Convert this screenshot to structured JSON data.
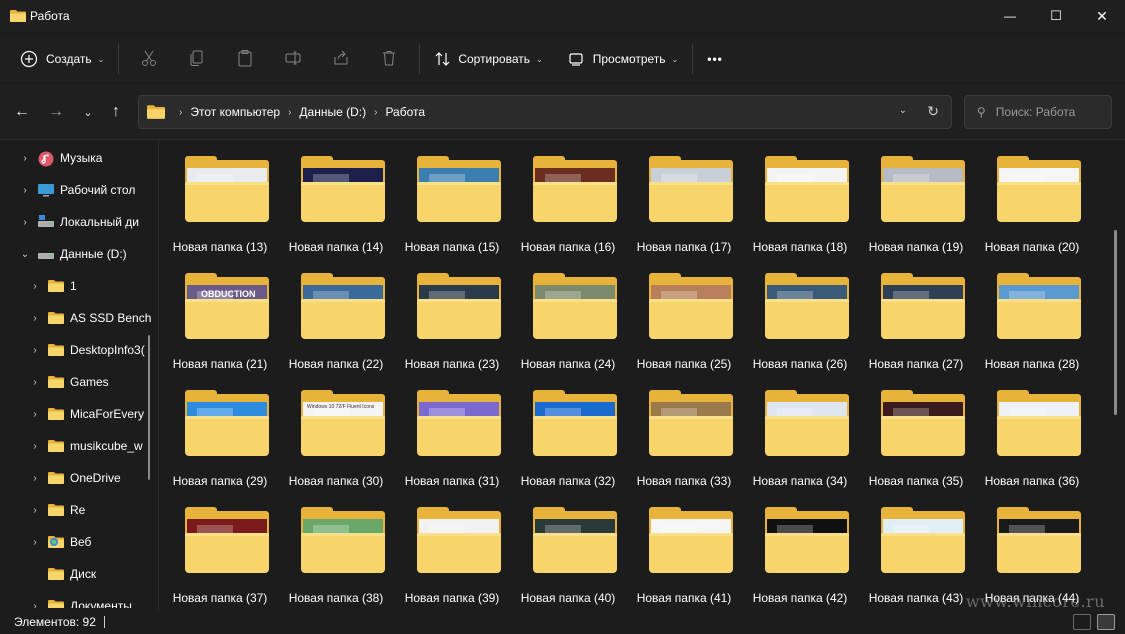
{
  "window": {
    "title": "Работа",
    "controls": {
      "minimize": "—",
      "maximize": "☐",
      "close": "✕"
    }
  },
  "toolbar": {
    "create_label": "Создать",
    "sort_label": "Сортировать",
    "view_label": "Просмотреть",
    "more_label": "•••"
  },
  "address": {
    "breadcrumbs": [
      "Этот компьютер",
      "Данные (D:)",
      "Работа"
    ],
    "search_placeholder": "Поиск: Работа"
  },
  "sidebar": {
    "items": [
      {
        "label": "Музыка",
        "icon": "music-icon",
        "expander": "›"
      },
      {
        "label": "Рабочий стол",
        "icon": "desktop-icon",
        "expander": "›"
      },
      {
        "label": "Локальный ди",
        "icon": "drive-icon",
        "expander": "›"
      },
      {
        "label": "Данные (D:)",
        "icon": "drive-icon",
        "expander": "⌄"
      },
      {
        "label": "1",
        "icon": "folder-icon",
        "expander": "›"
      },
      {
        "label": "AS SSD Bench",
        "icon": "folder-icon",
        "expander": "›"
      },
      {
        "label": "DesktopInfo3(",
        "icon": "folder-icon",
        "expander": "›"
      },
      {
        "label": "Games",
        "icon": "folder-icon",
        "expander": "›"
      },
      {
        "label": "MicaForEvery",
        "icon": "folder-icon",
        "expander": "›"
      },
      {
        "label": "musikcube_w",
        "icon": "folder-icon",
        "expander": "›"
      },
      {
        "label": "OneDrive",
        "icon": "folder-icon",
        "expander": "›"
      },
      {
        "label": "Re",
        "icon": "folder-icon",
        "expander": "›"
      },
      {
        "label": "Веб",
        "icon": "web-folder-icon",
        "expander": "›"
      },
      {
        "label": "Диск",
        "icon": "folder-icon",
        "expander": ""
      },
      {
        "label": "Документы",
        "icon": "folder-icon",
        "expander": "›"
      }
    ]
  },
  "folders": [
    {
      "label": "Новая папка (13)"
    },
    {
      "label": "Новая папка (14)"
    },
    {
      "label": "Новая папка (15)"
    },
    {
      "label": "Новая папка (16)"
    },
    {
      "label": "Новая папка (17)"
    },
    {
      "label": "Новая папка (18)"
    },
    {
      "label": "Новая папка (19)"
    },
    {
      "label": "Новая папка (20)"
    },
    {
      "label": "Новая папка (21)"
    },
    {
      "label": "Новая папка (22)"
    },
    {
      "label": "Новая папка (23)"
    },
    {
      "label": "Новая папка (24)"
    },
    {
      "label": "Новая папка (25)"
    },
    {
      "label": "Новая папка (26)"
    },
    {
      "label": "Новая папка (27)"
    },
    {
      "label": "Новая папка (28)"
    },
    {
      "label": "Новая папка (29)"
    },
    {
      "label": "Новая папка (30)"
    },
    {
      "label": "Новая папка (31)"
    },
    {
      "label": "Новая папка (32)"
    },
    {
      "label": "Новая папка (33)"
    },
    {
      "label": "Новая папка (34)"
    },
    {
      "label": "Новая папка (35)"
    },
    {
      "label": "Новая папка (36)"
    },
    {
      "label": "Новая папка (37)"
    },
    {
      "label": "Новая папка (38)"
    },
    {
      "label": "Новая папка (39)"
    },
    {
      "label": "Новая папка (40)"
    },
    {
      "label": "Новая папка (41)"
    },
    {
      "label": "Новая папка (42)"
    },
    {
      "label": "Новая папка (43)"
    },
    {
      "label": "Новая папка (44)"
    }
  ],
  "thumb_colors": [
    "#e9ecef",
    "#1b1f4a",
    "#3a7fb0",
    "#6b2d1f",
    "#c9cfd6",
    "#f4f4f4",
    "#b7bcc4",
    "#f5f5f5",
    "#6a5a8a",
    "#3a6a9a",
    "#2b3a4a",
    "#7a8a6a",
    "#b8805a",
    "#3a5a7a",
    "#2f3f55",
    "#5a9ad0",
    "#2d8ce0",
    "#f4f4f4",
    "#7a6ad0",
    "#1a6ad0",
    "#9a7a4a",
    "#dfe6f0",
    "#3a1a1a",
    "#eef1f5",
    "#7a1a1a",
    "#6aa86a",
    "#f2f2f2",
    "#2a3a3a",
    "#f6f6f6",
    "#101010",
    "#e0eef8",
    "#1a1a1a"
  ],
  "thumb_text": {
    "folder_30": "Windows 10 72/F Fluent Icons",
    "folder_21": "OBDUCTION"
  },
  "status": {
    "items_count": "Элементов: 92"
  },
  "watermark": "www.wincore.ru",
  "colors": {
    "background": "#1c1c1c",
    "folder_back": "#e8b33a",
    "folder_front": "#f8d56a"
  }
}
